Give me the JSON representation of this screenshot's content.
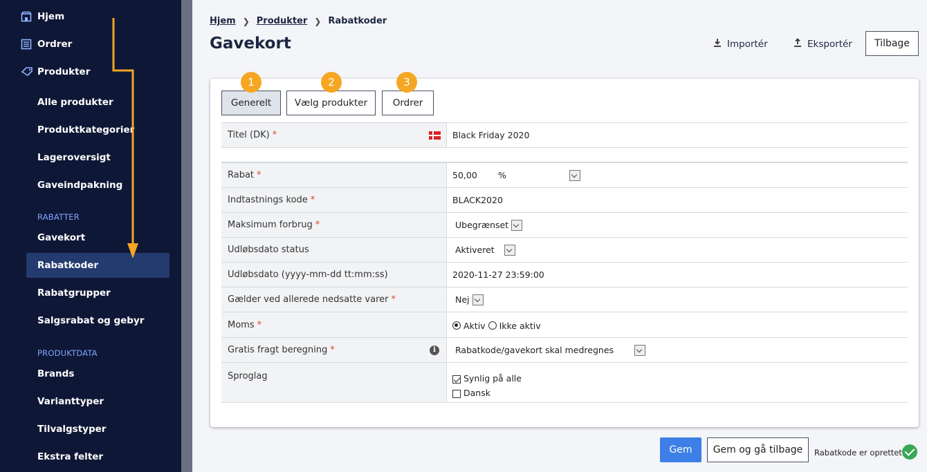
{
  "sidebar": {
    "top_items": [
      {
        "label": "Hjem",
        "icon": "store-icon"
      },
      {
        "label": "Ordrer",
        "icon": "list-icon"
      },
      {
        "label": "Produkter",
        "icon": "tag-icon"
      }
    ],
    "products_items": [
      "Alle produkter",
      "Produktkategorier",
      "Lageroversigt",
      "Gaveindpakning"
    ],
    "section_rabatter": "RABATTER",
    "rabatter_items": [
      "Gavekort",
      "Rabatkoder",
      "Rabatgrupper",
      "Salgsrabat og gebyr"
    ],
    "active_item": "Rabatkoder",
    "section_produktdata": "PRODUKTDATA",
    "produktdata_items": [
      "Brands",
      "Varianttyper",
      "Tilvalgstyper",
      "Ekstra felter"
    ]
  },
  "breadcrumb": {
    "home": "Hjem",
    "products": "Produkter",
    "current": "Rabatkoder"
  },
  "page_title": "Gavekort",
  "header": {
    "import_label": "Importér",
    "export_label": "Eksportér",
    "back_label": "Tilbage"
  },
  "tabs": [
    {
      "label": "Generelt",
      "badge": "1",
      "active": true
    },
    {
      "label": "Vælg produkter",
      "badge": "2",
      "active": false
    },
    {
      "label": "Ordrer",
      "badge": "3",
      "active": false
    }
  ],
  "form": {
    "title_label": "Titel (DK)",
    "title_value": "Black Friday 2020",
    "discount_label": "Rabat",
    "discount_value": "50,00",
    "discount_unit": "%",
    "code_label": "Indtastnings kode",
    "code_value": "BLACK2020",
    "max_usage_label": "Maksimum forbrug",
    "max_usage_value": "Ubegrænset",
    "expiry_status_label": "Udløbsdato status",
    "expiry_status_value": "Aktiveret",
    "expiry_date_label": "Udløbsdato (yyyy-mm-dd tt:mm:ss)",
    "expiry_date_value": "2020-11-27 23:59:00",
    "discounted_label": "Gælder ved allerede nedsatte varer",
    "discounted_value": "Nej",
    "vat_label": "Moms",
    "vat_option_active": "Aktiv",
    "vat_option_inactive": "Ikke aktiv",
    "vat_selected": "Aktiv",
    "free_shipping_label": "Gratis fragt beregning",
    "free_shipping_value": "Rabatkode/gavekort skal medregnes",
    "language_label": "Sproglag",
    "language_all": "Synlig på alle",
    "language_all_checked": true,
    "language_danish": "Dansk",
    "language_danish_checked": false
  },
  "footer": {
    "save_label": "Gem",
    "save_back_label": "Gem og gå tilbage",
    "status_text": "Rabatkode er oprettet!"
  },
  "colors": {
    "sidebar_bg": "#0f1736",
    "accent_blue": "#3d7fe6",
    "badge_orange": "#f5a623",
    "success_green": "#3aa856",
    "required_red": "#e0462a"
  }
}
